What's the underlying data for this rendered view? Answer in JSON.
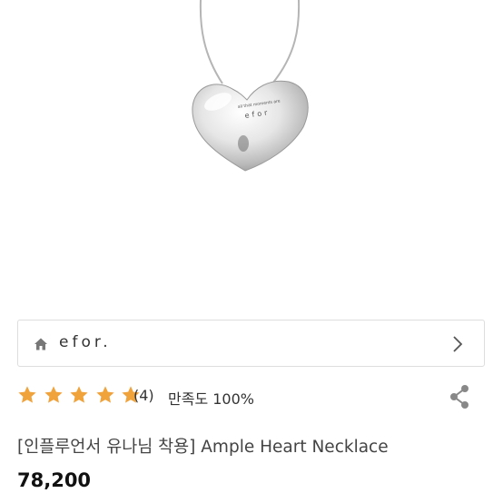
{
  "product": {
    "pendant_engraving_line1": "all that moments are",
    "pendant_engraving_line2": "efor",
    "title": "[인플루언서 유나님 착용] Ample Heart Necklace",
    "price": "78,200"
  },
  "shop": {
    "name": "efor.",
    "home_icon": "home-icon",
    "chevron_icon": "chevron-right-icon"
  },
  "rating": {
    "stars": 5,
    "star_color": "#f0a23b",
    "review_count": "(4)",
    "satisfaction": "만족도 100%"
  },
  "share": {
    "icon": "share-icon"
  }
}
